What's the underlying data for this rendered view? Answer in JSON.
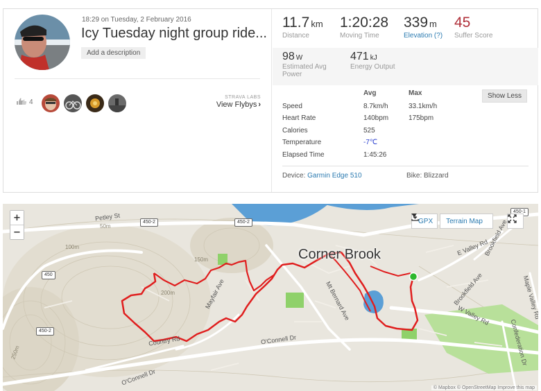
{
  "activity": {
    "datetime": "18:29 on Tuesday, 2 February 2016",
    "title": "Icy Tuesday night group ride...",
    "add_description": "Add a description",
    "kudos_count": "4",
    "strava_labs": "STRAVA LABS",
    "view_flybys": "View Flybys",
    "flyby_arrow": "›"
  },
  "stats": {
    "distance": {
      "value": "11.7",
      "unit": "km",
      "label": "Distance"
    },
    "moving_time": {
      "value": "1:20:28",
      "label": "Moving Time"
    },
    "elevation": {
      "value": "339",
      "unit": "m",
      "label": "Elevation (?)"
    },
    "suffer": {
      "value": "45",
      "label": "Suffer Score"
    },
    "power": {
      "value": "98",
      "unit": "W",
      "label": "Estimated Avg Power"
    },
    "energy": {
      "value": "471",
      "unit": "kJ",
      "label": "Energy Output"
    }
  },
  "details": {
    "show_less": "Show Less",
    "col_avg": "Avg",
    "col_max": "Max",
    "rows": [
      {
        "label": "Speed",
        "avg": "8.7km/h",
        "max": "33.1km/h"
      },
      {
        "label": "Heart Rate",
        "avg": "140bpm",
        "max": "175bpm"
      },
      {
        "label": "Calories",
        "avg": "525",
        "max": ""
      },
      {
        "label": "Temperature",
        "avg": "-7℃",
        "max": ""
      },
      {
        "label": "Elapsed Time",
        "avg": "1:45:26",
        "max": ""
      }
    ],
    "device_label": "Device:",
    "device_value": "Garmin Edge 510",
    "bike_label": "Bike: Blizzard"
  },
  "map": {
    "zoom_in": "+",
    "zoom_out": "−",
    "gpx": "GPX",
    "terrain_map": "Terrain Map",
    "city": "Corner Brook",
    "attribution": "© Mapbox © OpenStreetMap Improve this map",
    "labels": {
      "petley": "Petley St",
      "mayfair": "Mayfair Ave",
      "country": "Country Rd",
      "oconnell1": "O'Connell Dr",
      "oconnell2": "O'Connell Dr",
      "mtbernard": "Mt Bernard Ave",
      "evalley": "E Valley Rd",
      "brookfield1": "Brookfield Ave",
      "brookfield2": "Brookfield Ave",
      "wvalley": "W Valley Rd",
      "maple": "Maple Valley Rd",
      "confed": "Confederation Dr",
      "m50": "50m",
      "m100": "100m",
      "m150": "150m",
      "m200": "200m",
      "m250": "250m"
    },
    "shields": {
      "s1": "450-2",
      "s2": "450-2",
      "s3": "450",
      "s4": "450-2",
      "s5": "450-1"
    },
    "colors": {
      "route": "#e01e1e",
      "water": "#5b9fd6",
      "park": "#8fd16a",
      "start": "#2db82d"
    }
  }
}
